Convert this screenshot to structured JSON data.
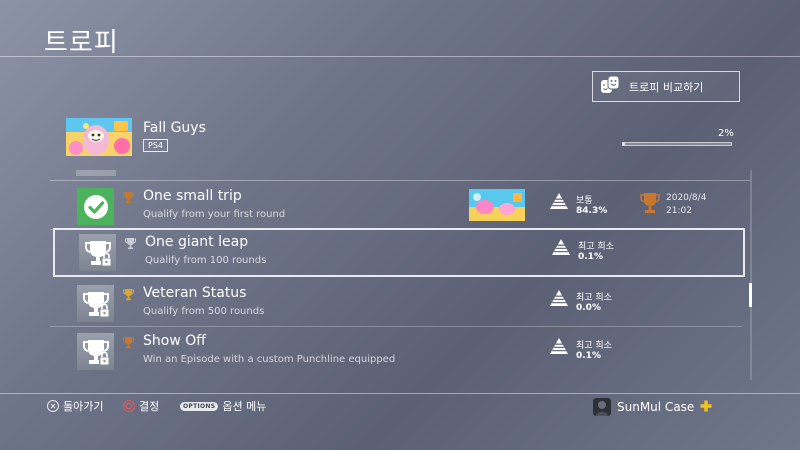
{
  "header": {
    "title": "트로피"
  },
  "compare_button": {
    "label": "트로피 비교하기",
    "icon": "compare-faces-icon"
  },
  "game": {
    "title": "Fall Guys",
    "platform": "PS4",
    "progress_label": "2%",
    "progress": 0.02
  },
  "trophies": [
    {
      "name": "One small trip",
      "description": "Qualify from your first round",
      "grade": "bronze",
      "status": "earned",
      "tile_icon": "check-icon",
      "rarity_label": "보통",
      "rarity_pct": "84.3%",
      "earned_date": "2020/8/4",
      "earned_time": "21:02",
      "has_screenshot": true
    },
    {
      "name": "One giant leap",
      "description": "Qualify from 100 rounds",
      "grade": "silver",
      "status": "locked",
      "tile_icon": "locked-trophy-icon",
      "rarity_label": "최고 희소",
      "rarity_pct": "0.1%",
      "selected": true
    },
    {
      "name": "Veteran Status",
      "description": "Qualify from 500 rounds",
      "grade": "gold",
      "status": "locked",
      "tile_icon": "locked-trophy-icon",
      "rarity_label": "최고 희소",
      "rarity_pct": "0.0%"
    },
    {
      "name": "Show Off",
      "description": "Win an Episode with a custom Punchline equipped",
      "grade": "bronze",
      "status": "locked",
      "tile_icon": "locked-trophy-icon",
      "rarity_label": "최고 희소",
      "rarity_pct": "0.1%"
    }
  ],
  "footer": {
    "back_label": "돌아가기",
    "confirm_label": "결정",
    "options_badge": "OPTIONS",
    "options_label": "옵션 메뉴",
    "user_name": "SunMul Case",
    "plus_icon": "ps-plus-icon"
  },
  "colors": {
    "bronze": "#c8782e",
    "silver": "#c9ced6",
    "gold": "#d9a92e",
    "earned_tile": "#4ab35c",
    "ps_plus": "#f2c21b"
  }
}
